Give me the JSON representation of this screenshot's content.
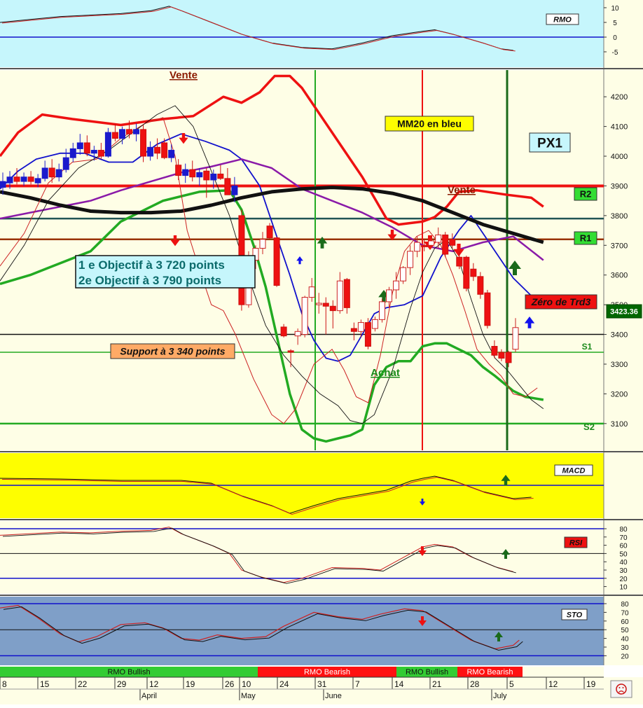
{
  "colors": {
    "rmo_bg": "#c6f6fc",
    "main_bg": "#fefee6",
    "macd_bg": "#fefe00",
    "rsi_bg": "#fefee6",
    "sto_bg": "#7f9fc8",
    "axis_bg": "#fefee6",
    "bull": "#33cc33",
    "bear": "#ff1111",
    "ma_blue": "#1111cc",
    "ma_purple": "#8a1aa8",
    "ma_black": "#111111",
    "band_red": "#ee1111",
    "band_green": "#22aa22"
  },
  "panels": {
    "rmo": {
      "label": "RMO",
      "ticks": [
        "10",
        "5",
        "0",
        "-5"
      ]
    },
    "main": {
      "price_ticks": [
        "4200",
        "4100",
        "4000",
        "3900",
        "3800",
        "3700",
        "3600",
        "3500",
        "3400",
        "3300",
        "3200",
        "3100"
      ],
      "current_price": "3423.36"
    },
    "macd": {
      "label": "MACD"
    },
    "rsi": {
      "label": "RSI",
      "ticks": [
        "80",
        "70",
        "60",
        "50",
        "40",
        "30",
        "20",
        "10"
      ]
    },
    "sto": {
      "label": "STO",
      "ticks": [
        "80",
        "70",
        "60",
        "50",
        "40",
        "30",
        "20"
      ]
    }
  },
  "annotations": {
    "vente_top": "Vente",
    "vente_right": "Vente",
    "mm20": "MM20 en bleu",
    "px1": "PX1",
    "r2": "R2",
    "r1": "R1",
    "s1": "S1",
    "s2": "S2",
    "objectif_1": "1 e Objectif  à 3 720  points",
    "objectif_2": "2e  Objectif  à 3 790  points",
    "support": "Support à 3 340 points",
    "achat": "Achat",
    "zero_trd3": "Zéro de Trd3"
  },
  "rmo_bar": [
    {
      "label": "RMO Bullish",
      "state": "bullish"
    },
    {
      "label": "RMO Bearish",
      "state": "bearish"
    },
    {
      "label": "RMO Bullish",
      "state": "bullish"
    },
    {
      "label": "RMO Bearish",
      "state": "bearish"
    }
  ],
  "date_axis": {
    "days": [
      "8",
      "15",
      "22",
      "29",
      "12",
      "19",
      "26",
      "10",
      "24",
      "31",
      "7",
      "14",
      "21",
      "28",
      "5",
      "12",
      "19"
    ],
    "months": [
      "April",
      "May",
      "June",
      "July"
    ]
  },
  "chart_data": {
    "type": "candlestick",
    "title": "",
    "ylim": [
      3010,
      4290
    ],
    "levels": [
      {
        "name": "R2",
        "value": 3790
      },
      {
        "name": "R1",
        "value": 3720
      },
      {
        "name": "S1",
        "value": 3340
      },
      {
        "name": "S2",
        "value": 3100
      }
    ],
    "horizontal_lines": [
      3900,
      3400
    ],
    "candles": [
      {
        "o": 3895,
        "h": 3945,
        "l": 3870,
        "c": 3915
      },
      {
        "o": 3910,
        "h": 3950,
        "l": 3890,
        "c": 3930
      },
      {
        "o": 3930,
        "h": 3960,
        "l": 3905,
        "c": 3915
      },
      {
        "o": 3915,
        "h": 3945,
        "l": 3900,
        "c": 3930
      },
      {
        "o": 3930,
        "h": 3950,
        "l": 3905,
        "c": 3915
      },
      {
        "o": 3910,
        "h": 3940,
        "l": 3895,
        "c": 3925
      },
      {
        "o": 3925,
        "h": 3985,
        "l": 3915,
        "c": 3960
      },
      {
        "o": 3960,
        "h": 3990,
        "l": 3910,
        "c": 3930
      },
      {
        "o": 3930,
        "h": 3975,
        "l": 3915,
        "c": 3955
      },
      {
        "o": 3955,
        "h": 4025,
        "l": 3945,
        "c": 3995
      },
      {
        "o": 3995,
        "h": 4045,
        "l": 3980,
        "c": 4025
      },
      {
        "o": 4025,
        "h": 4075,
        "l": 4005,
        "c": 4045
      },
      {
        "o": 4045,
        "h": 4070,
        "l": 4000,
        "c": 4010
      },
      {
        "o": 4010,
        "h": 4035,
        "l": 3985,
        "c": 4020
      },
      {
        "o": 4020,
        "h": 4045,
        "l": 3990,
        "c": 4000
      },
      {
        "o": 4000,
        "h": 4095,
        "l": 3995,
        "c": 4080
      },
      {
        "o": 4080,
        "h": 4110,
        "l": 4050,
        "c": 4060
      },
      {
        "o": 4060,
        "h": 4100,
        "l": 4040,
        "c": 4090
      },
      {
        "o": 4090,
        "h": 4120,
        "l": 4060,
        "c": 4075
      },
      {
        "o": 4075,
        "h": 4110,
        "l": 4050,
        "c": 4090
      },
      {
        "o": 4090,
        "h": 4105,
        "l": 3980,
        "c": 4000
      },
      {
        "o": 4000,
        "h": 4050,
        "l": 3985,
        "c": 4030
      },
      {
        "o": 4030,
        "h": 4060,
        "l": 3990,
        "c": 4010
      },
      {
        "o": 4045,
        "h": 4060,
        "l": 3990,
        "c": 3995
      },
      {
        "o": 3995,
        "h": 4040,
        "l": 3980,
        "c": 4020
      },
      {
        "o": 3970,
        "h": 3990,
        "l": 3920,
        "c": 3935
      },
      {
        "o": 3935,
        "h": 3975,
        "l": 3910,
        "c": 3955
      },
      {
        "o": 3955,
        "h": 3985,
        "l": 3915,
        "c": 3930
      },
      {
        "o": 3930,
        "h": 3960,
        "l": 3900,
        "c": 3945
      },
      {
        "o": 3950,
        "h": 3960,
        "l": 3860,
        "c": 3920
      },
      {
        "o": 3920,
        "h": 3955,
        "l": 3890,
        "c": 3940
      },
      {
        "o": 3940,
        "h": 3970,
        "l": 3920,
        "c": 3925
      },
      {
        "o": 3925,
        "h": 3960,
        "l": 3870,
        "c": 3870
      },
      {
        "o": 3870,
        "h": 3930,
        "l": 3845,
        "c": 3900
      },
      {
        "o": 3800,
        "h": 3820,
        "l": 3480,
        "c": 3500
      },
      {
        "o": 3500,
        "h": 3680,
        "l": 3490,
        "c": 3650
      },
      {
        "o": 3650,
        "h": 3700,
        "l": 3620,
        "c": 3690
      },
      {
        "o": 3690,
        "h": 3745,
        "l": 3670,
        "c": 3720
      },
      {
        "o": 3765,
        "h": 3775,
        "l": 3720,
        "c": 3725
      },
      {
        "o": 3725,
        "h": 3730,
        "l": 3560,
        "c": 3565
      },
      {
        "o": 3425,
        "h": 3435,
        "l": 3390,
        "c": 3395
      },
      {
        "o": 3345,
        "h": 3350,
        "l": 3290,
        "c": 3340
      },
      {
        "o": 3395,
        "h": 3420,
        "l": 3365,
        "c": 3410
      },
      {
        "o": 3400,
        "h": 3530,
        "l": 3390,
        "c": 3525
      },
      {
        "o": 3525,
        "h": 3590,
        "l": 3510,
        "c": 3560
      },
      {
        "o": 3500,
        "h": 3540,
        "l": 3470,
        "c": 3505
      },
      {
        "o": 3505,
        "h": 3525,
        "l": 3400,
        "c": 3495
      },
      {
        "o": 3495,
        "h": 3515,
        "l": 3420,
        "c": 3480
      },
      {
        "o": 3480,
        "h": 3610,
        "l": 3470,
        "c": 3580
      },
      {
        "o": 3585,
        "h": 3590,
        "l": 3470,
        "c": 3490
      },
      {
        "o": 3420,
        "h": 3440,
        "l": 3380,
        "c": 3410
      },
      {
        "o": 3410,
        "h": 3450,
        "l": 3390,
        "c": 3440
      },
      {
        "o": 3440,
        "h": 3455,
        "l": 3350,
        "c": 3360
      },
      {
        "o": 3420,
        "h": 3460,
        "l": 3410,
        "c": 3450
      },
      {
        "o": 3450,
        "h": 3520,
        "l": 3440,
        "c": 3510
      },
      {
        "o": 3510,
        "h": 3560,
        "l": 3490,
        "c": 3550
      },
      {
        "o": 3550,
        "h": 3610,
        "l": 3520,
        "c": 3580
      },
      {
        "o": 3580,
        "h": 3630,
        "l": 3570,
        "c": 3625
      },
      {
        "o": 3625,
        "h": 3700,
        "l": 3600,
        "c": 3680
      },
      {
        "o": 3680,
        "h": 3730,
        "l": 3660,
        "c": 3710
      },
      {
        "o": 3700,
        "h": 3720,
        "l": 3680,
        "c": 3695
      },
      {
        "o": 3700,
        "h": 3730,
        "l": 3690,
        "c": 3715
      },
      {
        "o": 3710,
        "h": 3760,
        "l": 3690,
        "c": 3735
      },
      {
        "o": 3735,
        "h": 3745,
        "l": 3660,
        "c": 3670
      },
      {
        "o": 3720,
        "h": 3740,
        "l": 3690,
        "c": 3700
      },
      {
        "o": 3660,
        "h": 3680,
        "l": 3620,
        "c": 3630
      },
      {
        "o": 3660,
        "h": 3665,
        "l": 3545,
        "c": 3555
      },
      {
        "o": 3620,
        "h": 3640,
        "l": 3580,
        "c": 3595
      },
      {
        "o": 3595,
        "h": 3610,
        "l": 3520,
        "c": 3535
      },
      {
        "o": 3540,
        "h": 3550,
        "l": 3420,
        "c": 3430
      },
      {
        "o": 3360,
        "h": 3380,
        "l": 3320,
        "c": 3330
      },
      {
        "o": 3340,
        "h": 3350,
        "l": 3310,
        "c": 3320
      },
      {
        "o": 3340,
        "h": 3345,
        "l": 3290,
        "c": 3305
      },
      {
        "o": 3350,
        "h": 3455,
        "l": 3340,
        "c": 3423
      }
    ],
    "series": [
      {
        "name": "",
        "kind": "band",
        "color": "#ee1111",
        "x": [
          0,
          0.03,
          0.07,
          0.12,
          0.2,
          0.27,
          0.32,
          0.37,
          0.4,
          0.43,
          0.455,
          0.48,
          0.5,
          0.52,
          0.55,
          0.6,
          0.64,
          0.66,
          0.7,
          0.72,
          0.74,
          0.76,
          0.79,
          0.84,
          0.88,
          0.9
        ],
        "y": [
          4000,
          4080,
          4140,
          4125,
          4105,
          4125,
          4135,
          4200,
          4180,
          4215,
          4270,
          4270,
          4230,
          4170,
          4080,
          3930,
          3790,
          3770,
          3780,
          3795,
          3830,
          3880,
          3885,
          3870,
          3860,
          3830
        ]
      },
      {
        "name": "",
        "kind": "band",
        "color": "#22aa22",
        "x": [
          0,
          0.05,
          0.1,
          0.15,
          0.2,
          0.27,
          0.33,
          0.38,
          0.4,
          0.42,
          0.44,
          0.46,
          0.48,
          0.5,
          0.52,
          0.54,
          0.56,
          0.58,
          0.6,
          0.62,
          0.64,
          0.66,
          0.68,
          0.7,
          0.72,
          0.74,
          0.76,
          0.78,
          0.8,
          0.82,
          0.85,
          0.87,
          0.9
        ],
        "y": [
          3570,
          3600,
          3640,
          3680,
          3780,
          3850,
          3880,
          3885,
          3820,
          3700,
          3560,
          3380,
          3200,
          3080,
          3050,
          3040,
          3050,
          3060,
          3080,
          3230,
          3290,
          3310,
          3310,
          3360,
          3370,
          3370,
          3350,
          3330,
          3290,
          3260,
          3210,
          3190,
          3180
        ]
      },
      {
        "name": "",
        "kind": "ma",
        "color": "#1111cc",
        "x": [
          0,
          0.03,
          0.06,
          0.1,
          0.14,
          0.18,
          0.22,
          0.26,
          0.3,
          0.34,
          0.38,
          0.4,
          0.43,
          0.46,
          0.48,
          0.5,
          0.52,
          0.54,
          0.56,
          0.58,
          0.6,
          0.62,
          0.64,
          0.67,
          0.7,
          0.73,
          0.76,
          0.78,
          0.8,
          0.82,
          0.85,
          0.88,
          0.9
        ],
        "y": [
          3890,
          3950,
          3990,
          4010,
          4010,
          3980,
          3980,
          4040,
          4075,
          4050,
          4020,
          3990,
          3900,
          3720,
          3600,
          3470,
          3380,
          3320,
          3310,
          3330,
          3400,
          3470,
          3490,
          3500,
          3530,
          3660,
          3750,
          3800,
          3740,
          3680,
          3590,
          3530,
          3510
        ]
      },
      {
        "name": "",
        "kind": "ma",
        "color": "#8a1aa8",
        "x": [
          0,
          0.05,
          0.1,
          0.15,
          0.2,
          0.25,
          0.3,
          0.35,
          0.4,
          0.45,
          0.5,
          0.55,
          0.6,
          0.65,
          0.7,
          0.75,
          0.8,
          0.85,
          0.9
        ],
        "y": [
          3790,
          3810,
          3830,
          3850,
          3885,
          3915,
          3945,
          3965,
          3990,
          3960,
          3890,
          3850,
          3810,
          3760,
          3700,
          3680,
          3710,
          3730,
          3650
        ]
      },
      {
        "name": "",
        "kind": "ma_long",
        "color": "#111111",
        "x": [
          0,
          0.05,
          0.1,
          0.15,
          0.2,
          0.25,
          0.3,
          0.35,
          0.4,
          0.45,
          0.5,
          0.55,
          0.6,
          0.65,
          0.7,
          0.75,
          0.8,
          0.85,
          0.9
        ],
        "y": [
          3880,
          3860,
          3835,
          3815,
          3810,
          3810,
          3815,
          3835,
          3860,
          3880,
          3890,
          3895,
          3890,
          3875,
          3850,
          3810,
          3770,
          3740,
          3710
        ]
      }
    ]
  }
}
